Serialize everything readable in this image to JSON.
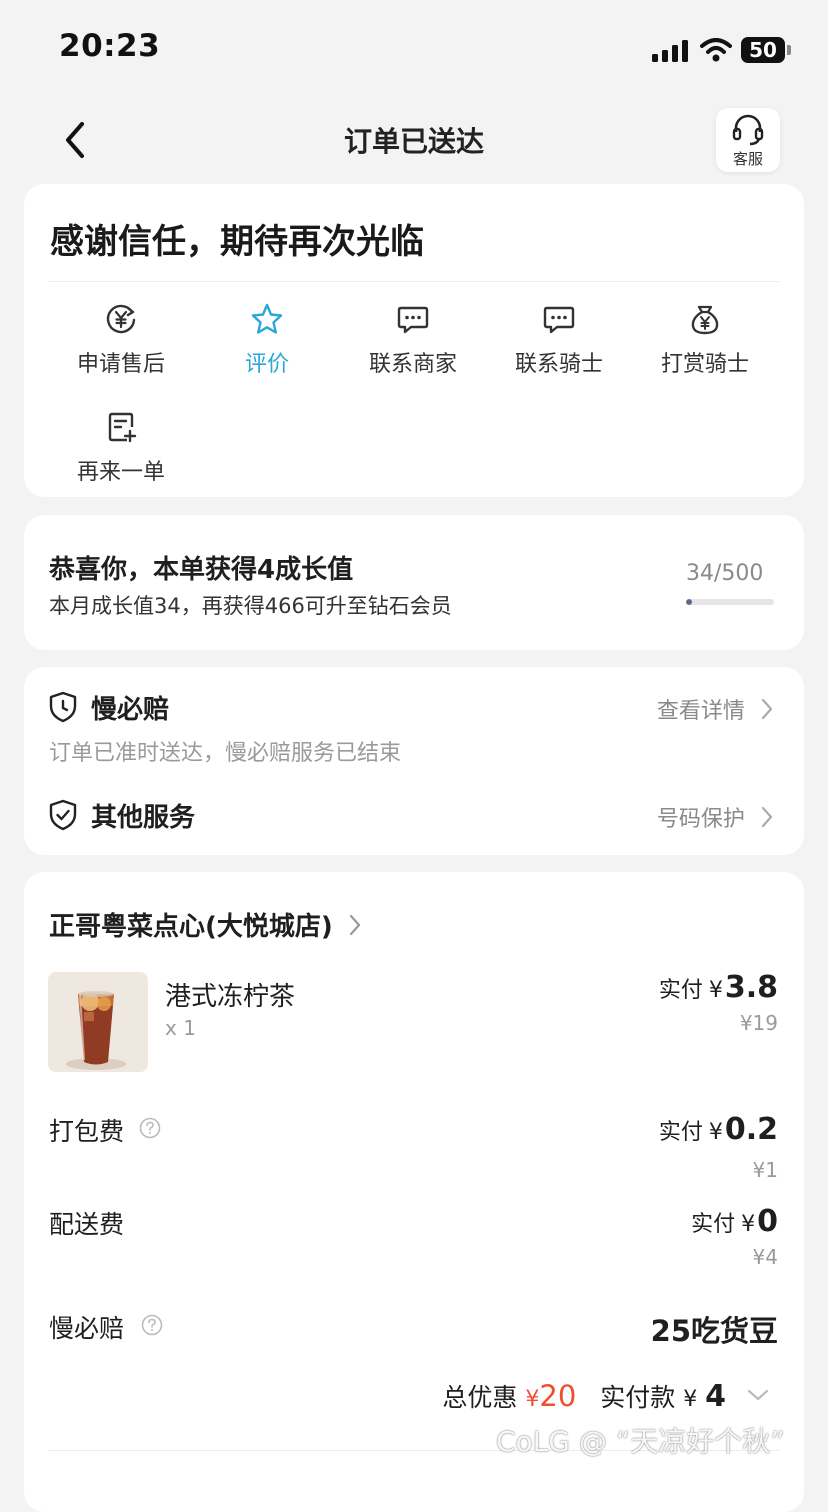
{
  "status_bar": {
    "time": "20:23",
    "battery": "50"
  },
  "nav": {
    "title": "订单已送达",
    "service_label": "客服"
  },
  "thanks": {
    "title": "感谢信任，期待再次光临",
    "actions": [
      {
        "label": "申请售后",
        "icon": "refund-icon"
      },
      {
        "label": "评价",
        "icon": "star-icon",
        "active": true
      },
      {
        "label": "联系商家",
        "icon": "chat-icon"
      },
      {
        "label": "联系骑士",
        "icon": "chat-icon"
      },
      {
        "label": "打赏骑士",
        "icon": "money-bag-icon"
      },
      {
        "label": "再来一单",
        "icon": "reorder-icon"
      }
    ]
  },
  "growth": {
    "title": "恭喜你，本单获得4成长值",
    "subtitle": "本月成长值34，再获得466可升至钻石会员",
    "progress_text": "34/500",
    "progress_fraction": 0.068
  },
  "services": {
    "slow_pay": {
      "title": "慢必赔",
      "link": "查看详情",
      "desc": "订单已准时送达，慢必赔服务已结束"
    },
    "other": {
      "title": "其他服务",
      "link": "号码保护"
    }
  },
  "order": {
    "shop_name": "正哥粤菜点心(大悦城店)",
    "item": {
      "name": "港式冻柠茶",
      "qty": "x 1",
      "paid_label": "实付",
      "currency": "¥",
      "paid": "3.8",
      "original": "¥19"
    },
    "packing": {
      "label": "打包费",
      "paid_label": "实付",
      "currency": "¥",
      "paid": "0.2",
      "original": "¥1"
    },
    "delivery": {
      "label": "配送费",
      "paid_label": "实付",
      "currency": "¥",
      "paid": "0",
      "original": "¥4"
    },
    "slow_pay_fee": {
      "label": "慢必赔",
      "value": "25吃货豆"
    },
    "totals": {
      "discount_label": "总优惠",
      "discount_currency": "¥",
      "discount": "20",
      "paid_label": "实付款",
      "paid_currency": "¥",
      "paid": "4"
    }
  },
  "watermark": "CoLG @ “天凉好个秋”",
  "colors": {
    "accent_blue": "#2aa7d8",
    "discount_red": "#ef4f2f",
    "background": "#f3f3f3"
  }
}
